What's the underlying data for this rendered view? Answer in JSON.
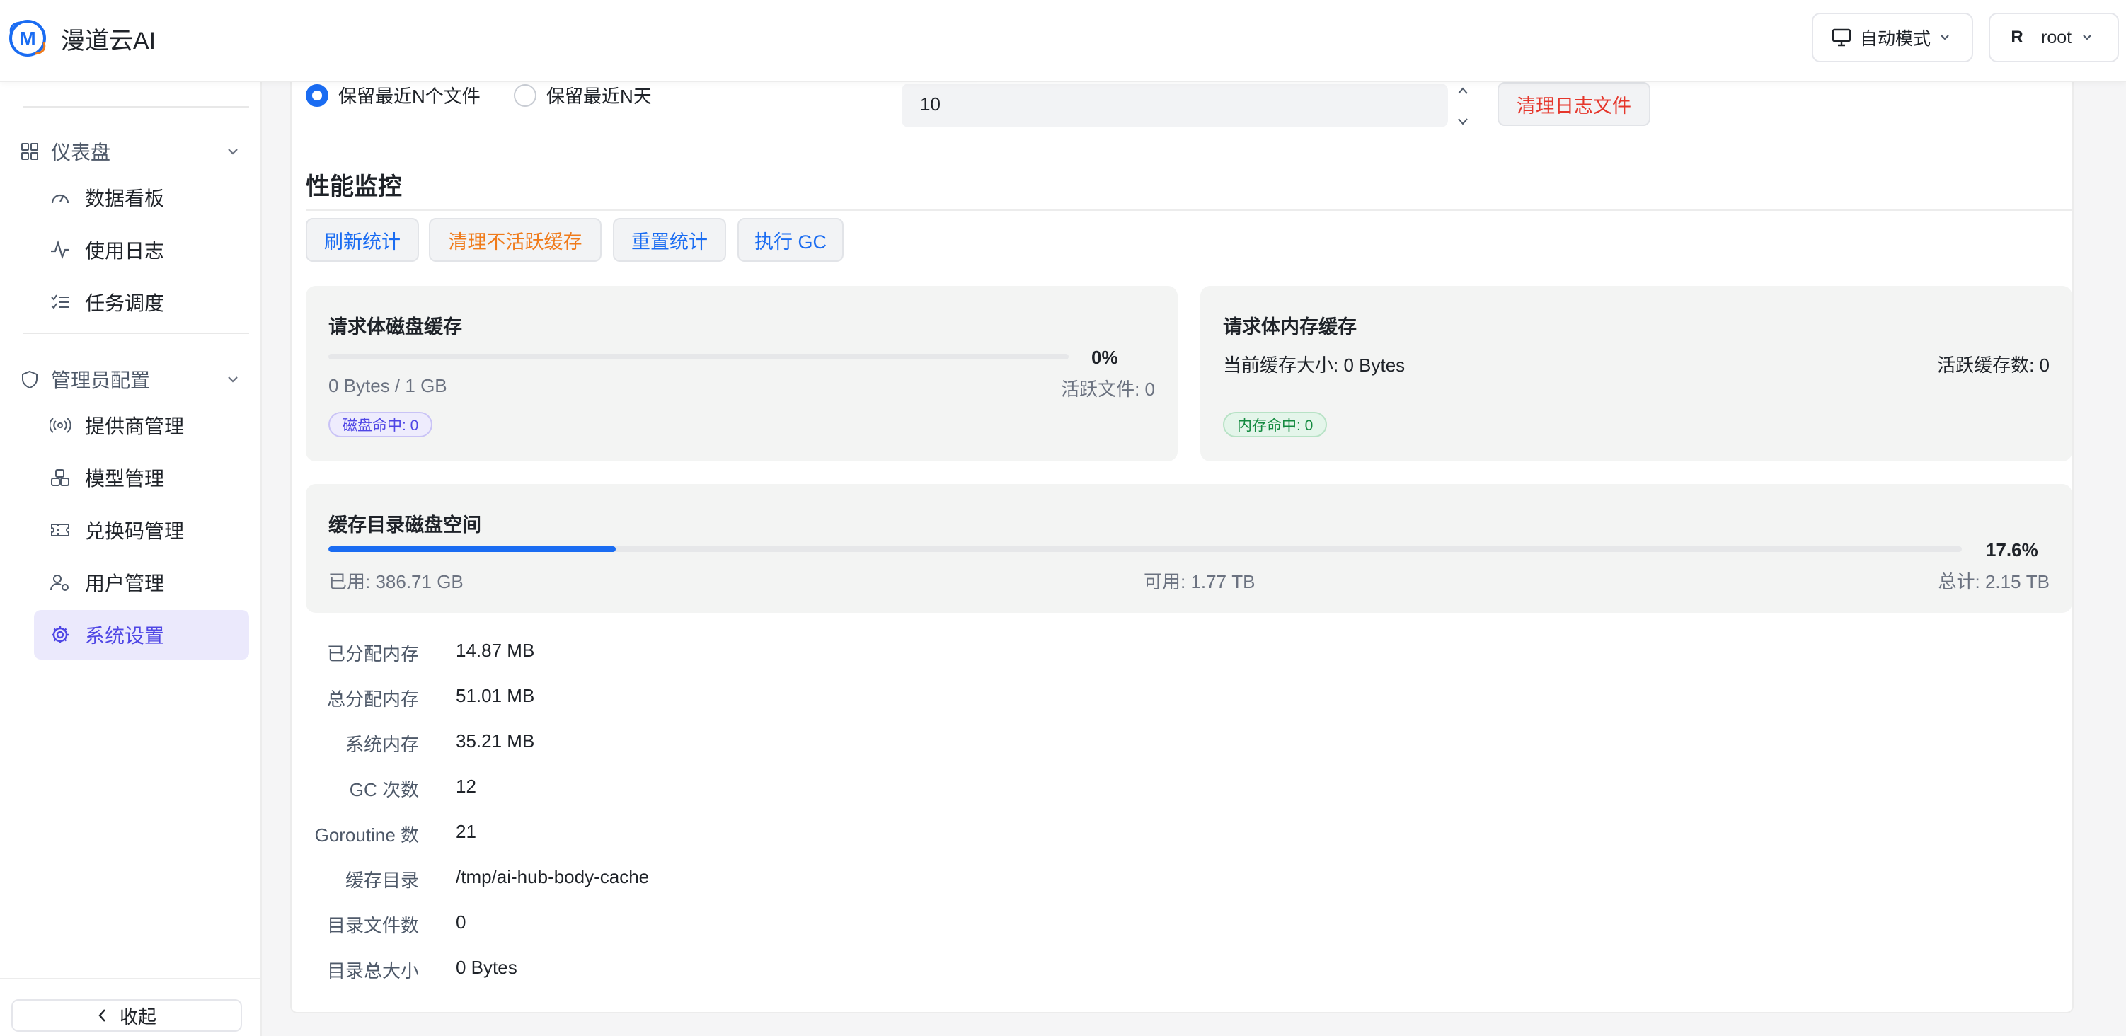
{
  "header": {
    "app_title": "漫道云AI",
    "logo_letter": "M",
    "mode_label": "自动模式",
    "user_initial": "R",
    "user_name": "root"
  },
  "sidebar": {
    "groups": [
      {
        "label": "仪表盘",
        "icon": "grid-icon",
        "items": [
          {
            "label": "数据看板",
            "icon": "gauge-icon"
          },
          {
            "label": "使用日志",
            "icon": "activity-icon"
          },
          {
            "label": "任务调度",
            "icon": "checklist-icon"
          }
        ]
      },
      {
        "label": "管理员配置",
        "icon": "shield-icon",
        "items": [
          {
            "label": "提供商管理",
            "icon": "broadcast-icon"
          },
          {
            "label": "模型管理",
            "icon": "boxes-icon"
          },
          {
            "label": "兑换码管理",
            "icon": "ticket-icon"
          },
          {
            "label": "用户管理",
            "icon": "user-gear-icon"
          },
          {
            "label": "系统设置",
            "icon": "settings-icon",
            "active": true
          }
        ]
      }
    ],
    "collapse_label": "收起"
  },
  "log_cleanup": {
    "radio_keep_files": "保留最近N个文件",
    "radio_keep_days": "保留最近N天",
    "selected": "keep_files",
    "count_value": "10",
    "clear_button": "清理日志文件"
  },
  "performance": {
    "title": "性能监控",
    "buttons": {
      "refresh": "刷新统计",
      "clear_inactive": "清理不活跃缓存",
      "reset": "重置统计",
      "gc": "执行 GC"
    },
    "disk_cache": {
      "title": "请求体磁盘缓存",
      "percent": "0%",
      "progress": 0,
      "size": "0 Bytes / 1 GB",
      "active_files": "活跃文件: 0",
      "hit_tag": "磁盘命中: 0"
    },
    "memory_cache": {
      "title": "请求体内存缓存",
      "current_size": "当前缓存大小: 0 Bytes",
      "active_count": "活跃缓存数: 0",
      "hit_tag": "内存命中: 0"
    },
    "dir_disk": {
      "title": "缓存目录磁盘空间",
      "percent": "17.6%",
      "progress": 0.176,
      "used": "已用: 386.71 GB",
      "available": "可用: 1.77 TB",
      "total": "总计: 2.15 TB"
    },
    "stats": [
      {
        "label": "已分配内存",
        "value": "14.87 MB"
      },
      {
        "label": "总分配内存",
        "value": "51.01 MB"
      },
      {
        "label": "系统内存",
        "value": "35.21 MB"
      },
      {
        "label": "GC 次数",
        "value": "12"
      },
      {
        "label": "Goroutine 数",
        "value": "21"
      },
      {
        "label": "缓存目录",
        "value": "/tmp/ai-hub-body-cache"
      },
      {
        "label": "目录文件数",
        "value": "0"
      },
      {
        "label": "目录总大小",
        "value": "0 Bytes"
      }
    ]
  },
  "colors": {
    "primary": "#1a6cf2",
    "accent_purple": "#4f46e5",
    "danger": "#e5362b",
    "warning": "#f07b1b",
    "success": "#138a3f"
  }
}
